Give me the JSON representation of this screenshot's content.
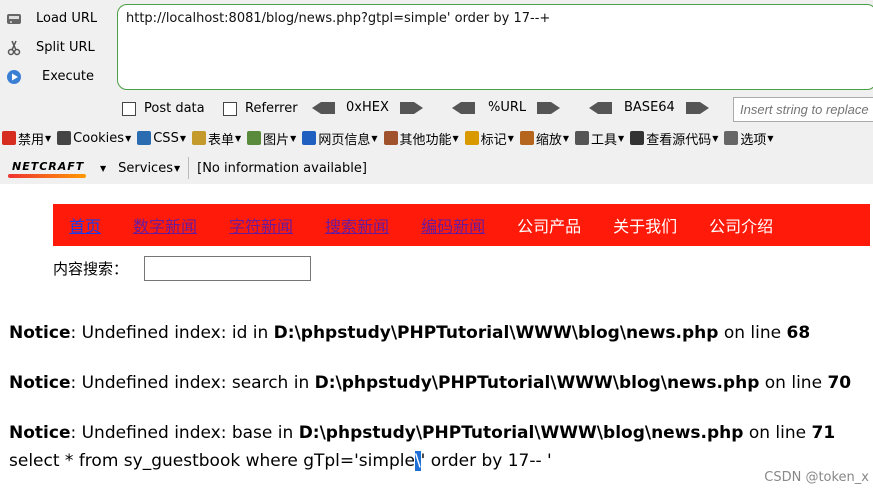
{
  "hackbar": {
    "actions": [
      {
        "label": "Load URL",
        "icon": "load-url-icon"
      },
      {
        "label": "Split URL",
        "icon": "scissors-icon"
      },
      {
        "label": "Execute",
        "icon": "execute-icon"
      }
    ],
    "url_value": "http://localhost:8081/blog/news.php?gtpl=simple' order by 17--+",
    "options": {
      "post_data": "Post data",
      "referrer": "Referrer",
      "hex": "0xHEX",
      "url": "%URL",
      "base64": "BASE64"
    },
    "insert_placeholder": "Insert string to replace"
  },
  "devbar": {
    "items": [
      {
        "label": "禁用",
        "icon": "disable-icon",
        "color": "#d62d20"
      },
      {
        "label": "Cookies",
        "icon": "cookie-icon",
        "color": "#444444"
      },
      {
        "label": "CSS",
        "icon": "css-icon",
        "color": "#2b6cb0"
      },
      {
        "label": "表单",
        "icon": "form-icon",
        "color": "#c49a2c"
      },
      {
        "label": "图片",
        "icon": "image-icon",
        "color": "#5a8a3c"
      },
      {
        "label": "网页信息",
        "icon": "info-icon",
        "color": "#1f5fbf"
      },
      {
        "label": "其他功能",
        "icon": "misc-icon",
        "color": "#a0522d"
      },
      {
        "label": "标记",
        "icon": "pencil-icon",
        "color": "#d99a00"
      },
      {
        "label": "缩放",
        "icon": "resize-icon",
        "color": "#b5651d"
      },
      {
        "label": "工具",
        "icon": "tools-icon",
        "color": "#555555"
      },
      {
        "label": "查看源代码",
        "icon": "source-icon",
        "color": "#333333"
      },
      {
        "label": "选项",
        "icon": "options-icon",
        "color": "#666666"
      }
    ]
  },
  "netbar": {
    "logo": "NETCRAFT",
    "services": "Services",
    "info": "[No information available]"
  },
  "nav": {
    "items": [
      {
        "label": "首页",
        "state": "home"
      },
      {
        "label": "数字新闻",
        "state": "visited"
      },
      {
        "label": "字符新闻",
        "state": "visited"
      },
      {
        "label": "搜索新闻",
        "state": "visited"
      },
      {
        "label": "编码新闻",
        "state": "visited"
      },
      {
        "label": "公司产品",
        "state": "plain"
      },
      {
        "label": "关于我们",
        "state": "plain"
      },
      {
        "label": "公司介绍",
        "state": "plain"
      }
    ]
  },
  "search": {
    "label": "内容搜索："
  },
  "notices": [
    {
      "prefix": "Notice",
      "message": ": Undefined index: id in ",
      "path": "D:\\phpstudy\\PHPTutorial\\WWW\\blog\\news.php",
      "on_line": " on line ",
      "line": "68"
    },
    {
      "prefix": "Notice",
      "message": ": Undefined index: search in ",
      "path": "D:\\phpstudy\\PHPTutorial\\WWW\\blog\\news.php",
      "on_line": " on line ",
      "line": "70"
    },
    {
      "prefix": "Notice",
      "message": ": Undefined index: base in ",
      "path": "D:\\phpstudy\\PHPTutorial\\WWW\\blog\\news.php",
      "on_line": " on line ",
      "line": "71"
    }
  ],
  "sql": {
    "before": "select * from sy_guestbook where gTpl='simple",
    "selected": "\\",
    "after": "' order by 17-- '"
  },
  "watermark": "CSDN @token_x"
}
